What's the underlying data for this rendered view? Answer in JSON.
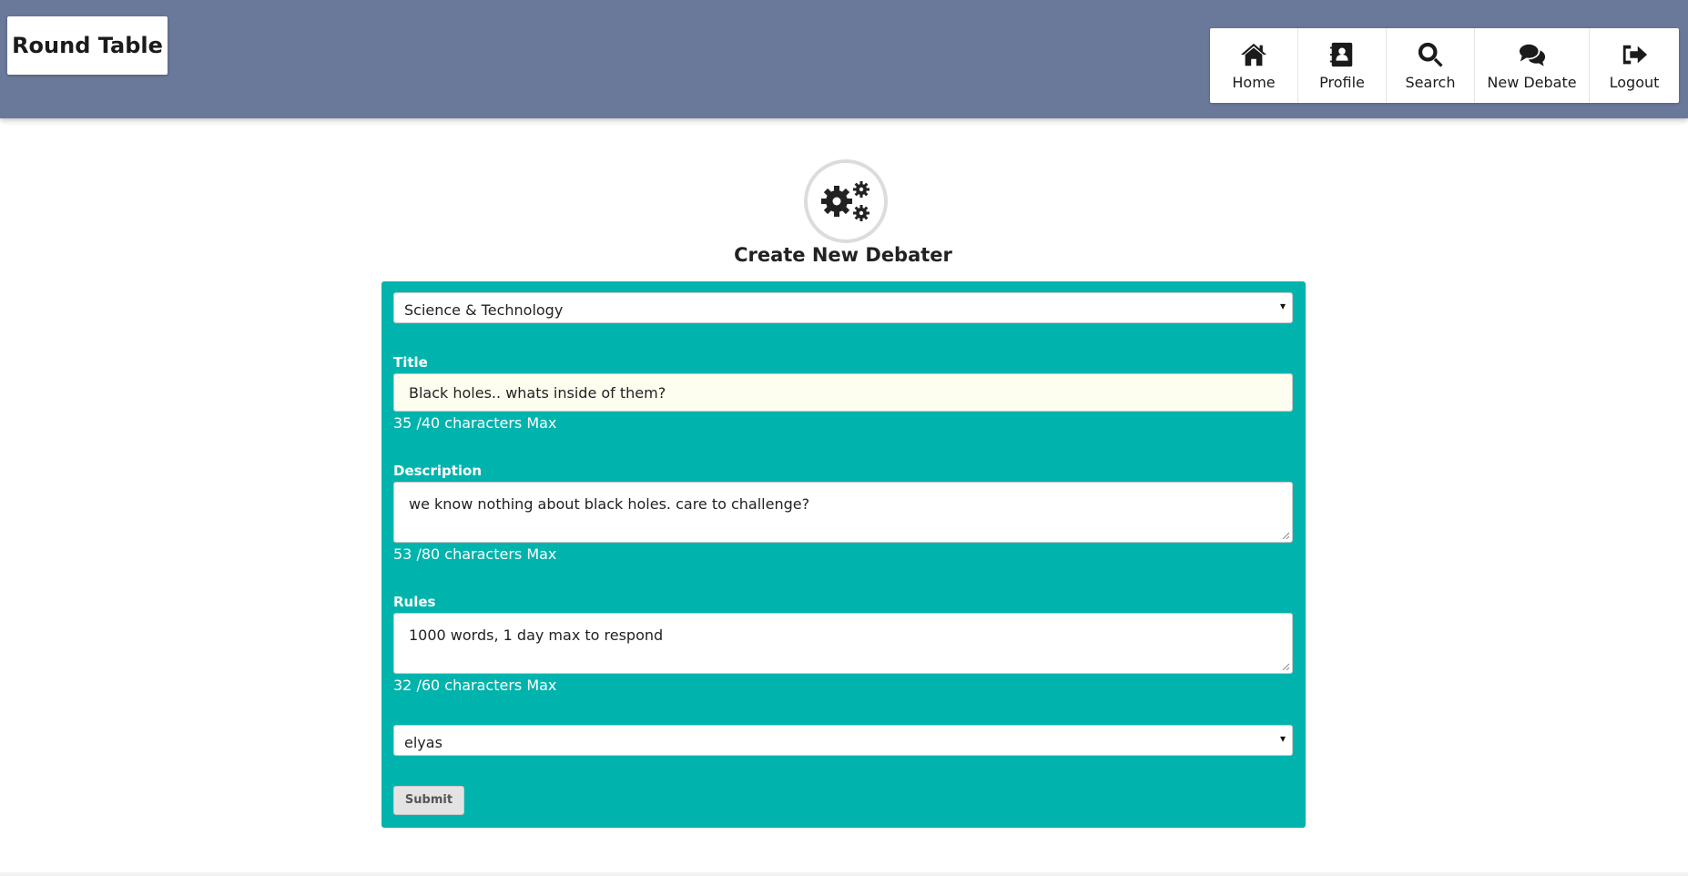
{
  "header": {
    "brand": "Round Table",
    "nav": [
      {
        "label": "Home",
        "icon": "home-icon"
      },
      {
        "label": "Profile",
        "icon": "address-book-icon"
      },
      {
        "label": "Search",
        "icon": "search-icon"
      },
      {
        "label": "New Debate",
        "icon": "comments-icon"
      },
      {
        "label": "Logout",
        "icon": "sign-out-icon"
      }
    ]
  },
  "page": {
    "icon": "cogs-icon",
    "title": "Create New Debater"
  },
  "form": {
    "category": "Science & Technology",
    "title_label": "Title",
    "title_value": "Black holes.. whats inside of them?",
    "title_counter": "35 /40 characters Max",
    "description_label": "Description",
    "description_value": "we know nothing about black holes. care to challenge?",
    "description_counter": "53 /80 characters Max",
    "rules_label": "Rules",
    "rules_value": "1000 words, 1 day max to respond",
    "rules_counter": "32 /60 characters Max",
    "opponent": "elyas",
    "submit_label": "Submit"
  },
  "colors": {
    "header_bg": "#6a7899",
    "form_bg": "#00b4ad"
  }
}
